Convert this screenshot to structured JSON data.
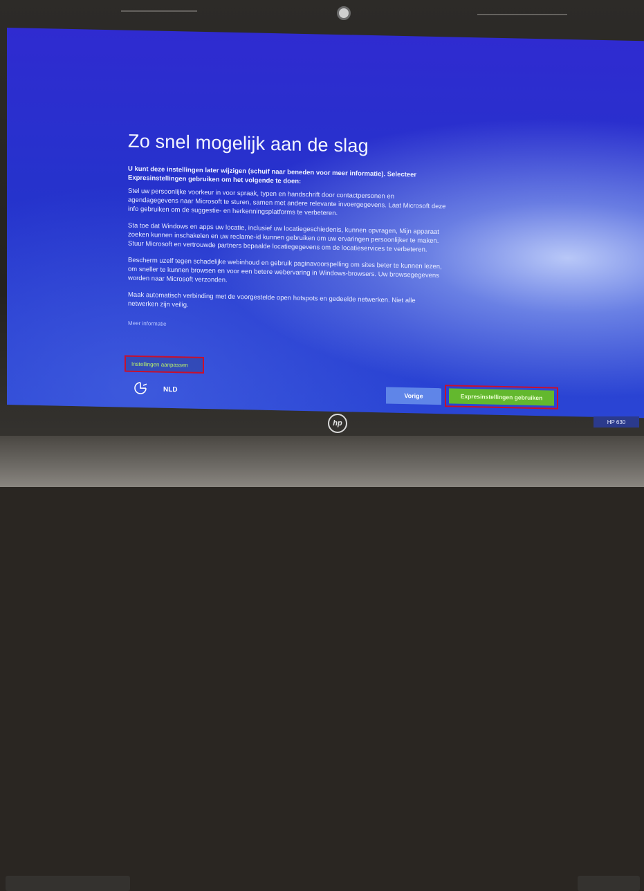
{
  "setup": {
    "title": "Zo snel mogelijk aan de slag",
    "intro": "U kunt deze instellingen later wijzigen (schuif naar beneden voor meer informatie). Selecteer Expresinstellingen gebruiken om het volgende te doen:",
    "paragraphs": [
      "Stel uw persoonlijke voorkeur in voor spraak, typen en handschrift door contactpersonen en agendagegevens naar Microsoft te sturen, samen met andere relevante invoergegevens. Laat Microsoft deze info gebruiken om de suggestie- en herkenningsplatforms te verbeteren.",
      "Sta toe dat Windows en apps uw locatie, inclusief uw locatiegeschiedenis, kunnen opvragen, Mijn apparaat zoeken kunnen inschakelen en uw reclame-id kunnen gebruiken om uw ervaringen persoonlijker te maken. Stuur Microsoft en vertrouwde partners bepaalde locatiegegevens om de locatieservices te verbeteren.",
      "Bescherm uzelf tegen schadelijke webinhoud en gebruik paginavoorspelling om sites beter te kunnen lezen, om sneller te kunnen browsen en voor een betere webervaring in Windows-browsers. Uw browsegegevens worden naar Microsoft verzonden.",
      "Maak automatisch verbinding met de voorgestelde open hotspots en gedeelde netwerken. Niet alle netwerken zijn veilig."
    ],
    "more_info": "Meer informatie",
    "customize": "Instellingen aanpassen",
    "language": "NLD",
    "back": "Vorige",
    "express": "Expresinstellingen gebruiken"
  },
  "device": {
    "brand": "hp",
    "model": "HP 630"
  },
  "colors": {
    "screen_blue": "#2533cc",
    "highlight_red": "#c8102e",
    "express_green": "#63b82e",
    "back_blue": "#5f85e8"
  },
  "icons": {
    "accessibility": "ease-of-access-icon"
  }
}
